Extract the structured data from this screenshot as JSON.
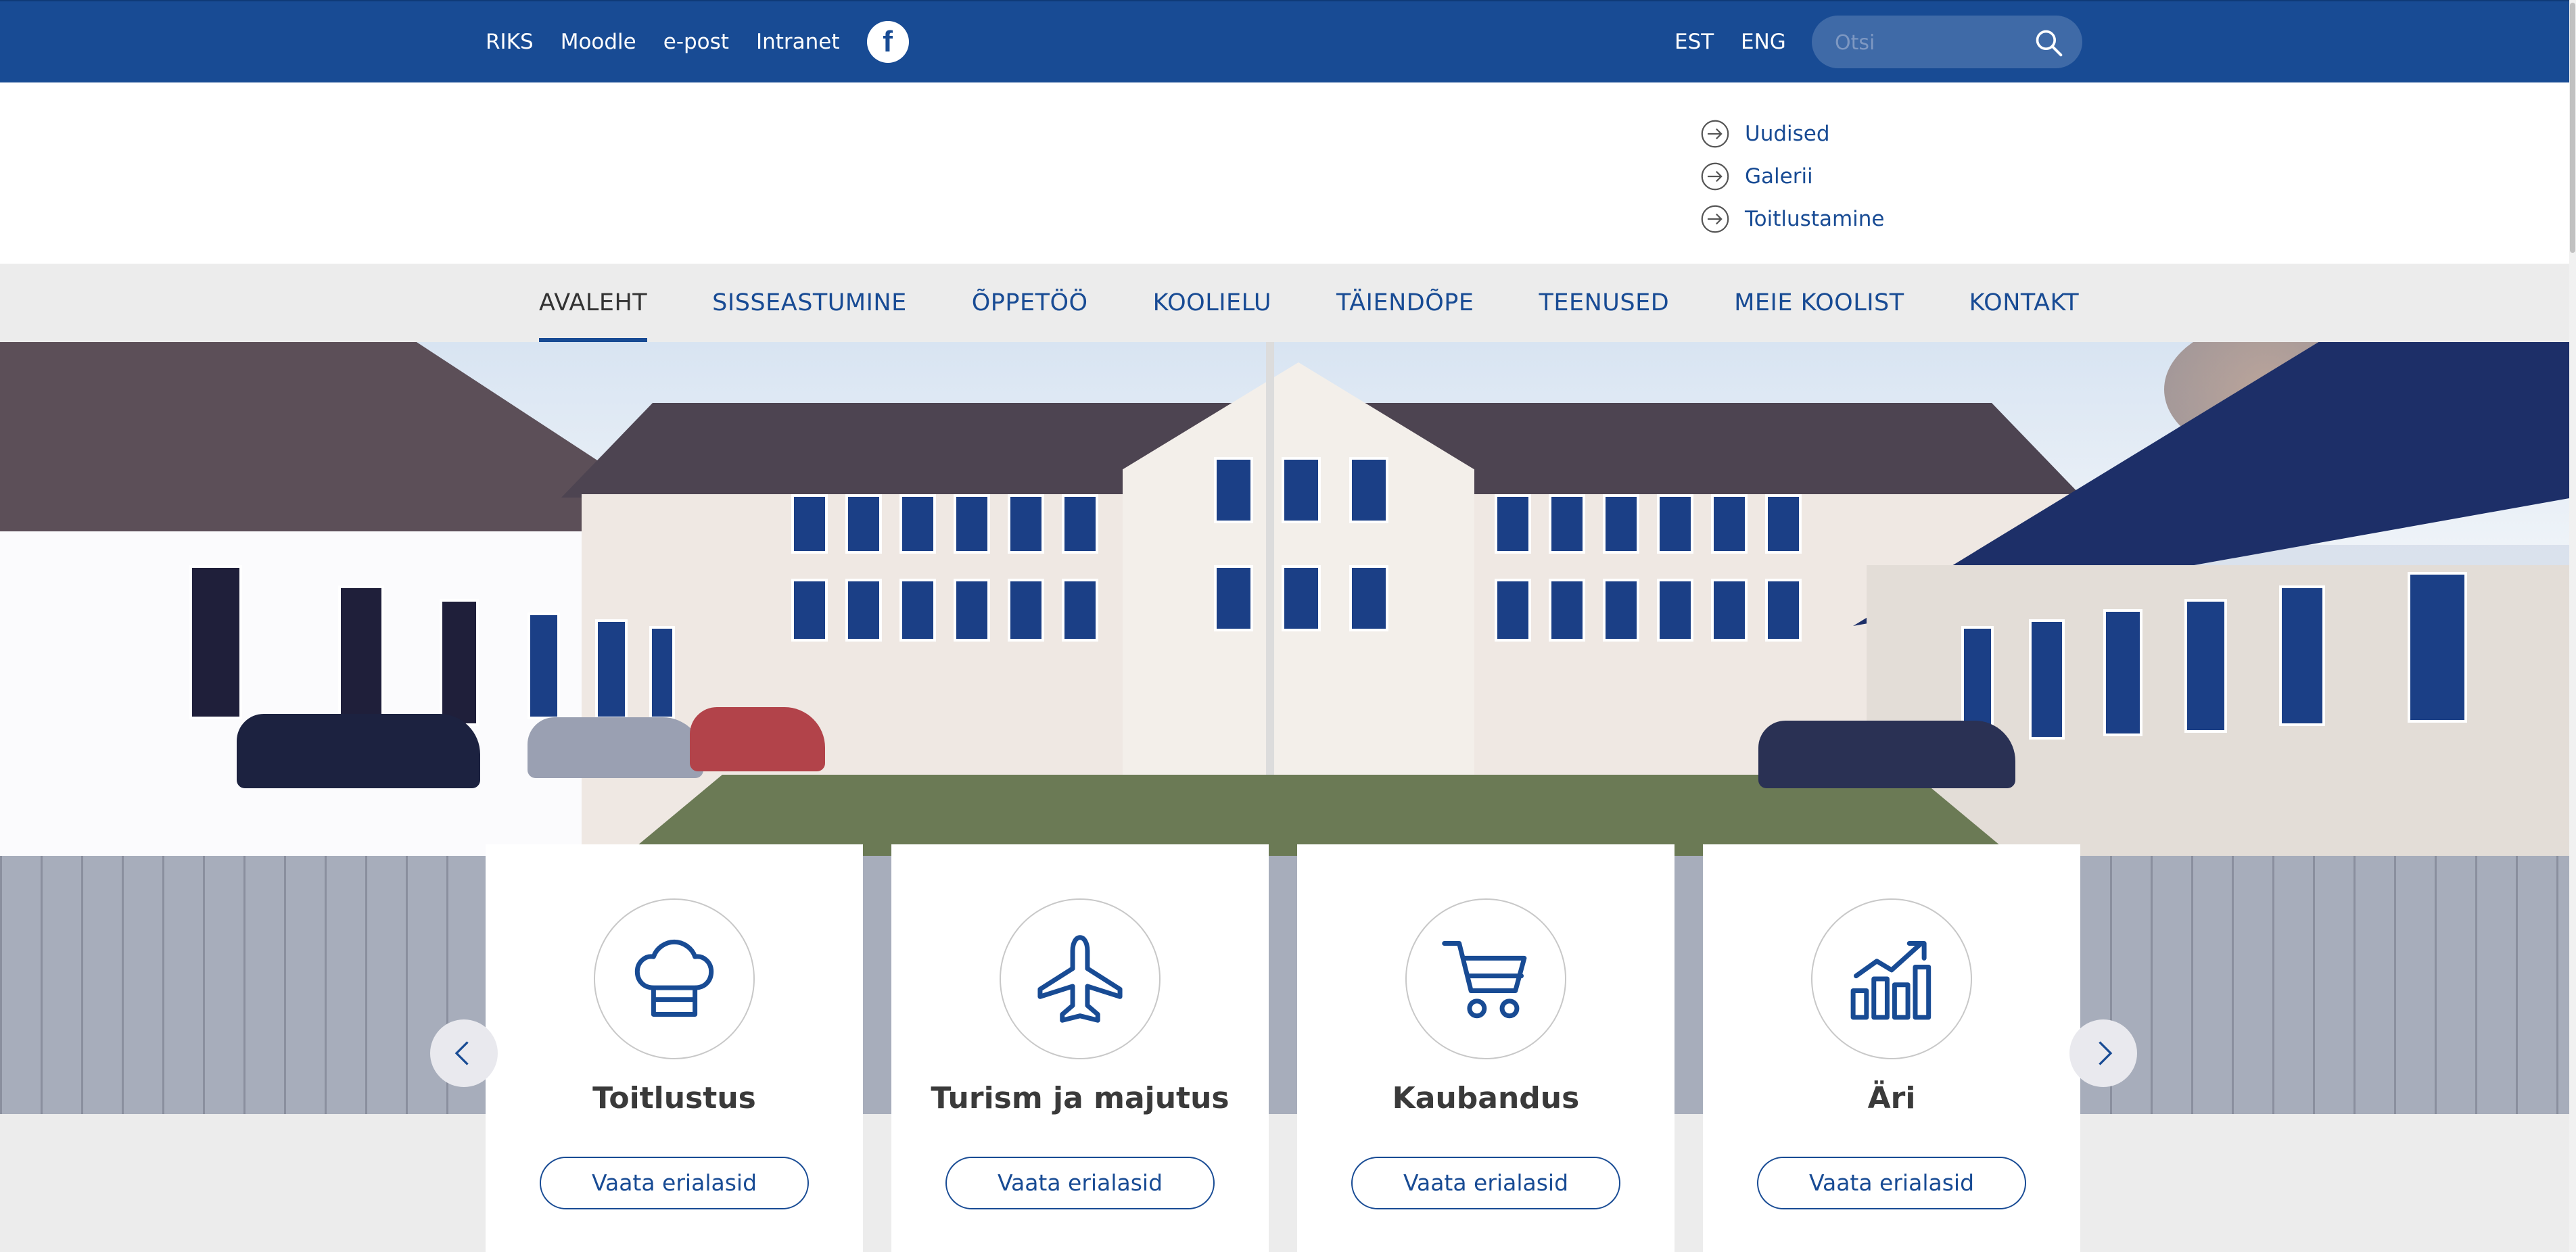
{
  "topbar": {
    "links": [
      "RIKS",
      "Moodle",
      "e-post",
      "Intranet"
    ],
    "facebook_icon": "facebook-icon",
    "languages": [
      "EST",
      "ENG"
    ],
    "search_placeholder": "Otsi",
    "search_icon": "search-icon"
  },
  "quicklinks": [
    "Uudised",
    "Galerii",
    "Toitlustamine"
  ],
  "nav": {
    "items": [
      "AVALEHT",
      "SISSEASTUMINE",
      "ÕPPETÖÖ",
      "KOOLIELU",
      "TÄIENDÕPE",
      "TEENUSED",
      "MEIE KOOLIST",
      "KONTAKT"
    ],
    "active": "AVALEHT"
  },
  "cards": [
    {
      "title": "Toitlustus",
      "icon": "chef-hat-icon",
      "button": "Vaata erialasid"
    },
    {
      "title": "Turism ja majutus",
      "icon": "airplane-icon",
      "button": "Vaata erialasid"
    },
    {
      "title": "Kaubandus",
      "icon": "shopping-cart-icon",
      "button": "Vaata erialasid"
    },
    {
      "title": "Äri",
      "icon": "bar-chart-growth-icon",
      "button": "Vaata erialasid"
    }
  ],
  "colors": {
    "brand": "#184b94",
    "nav_bg": "#ececec"
  }
}
